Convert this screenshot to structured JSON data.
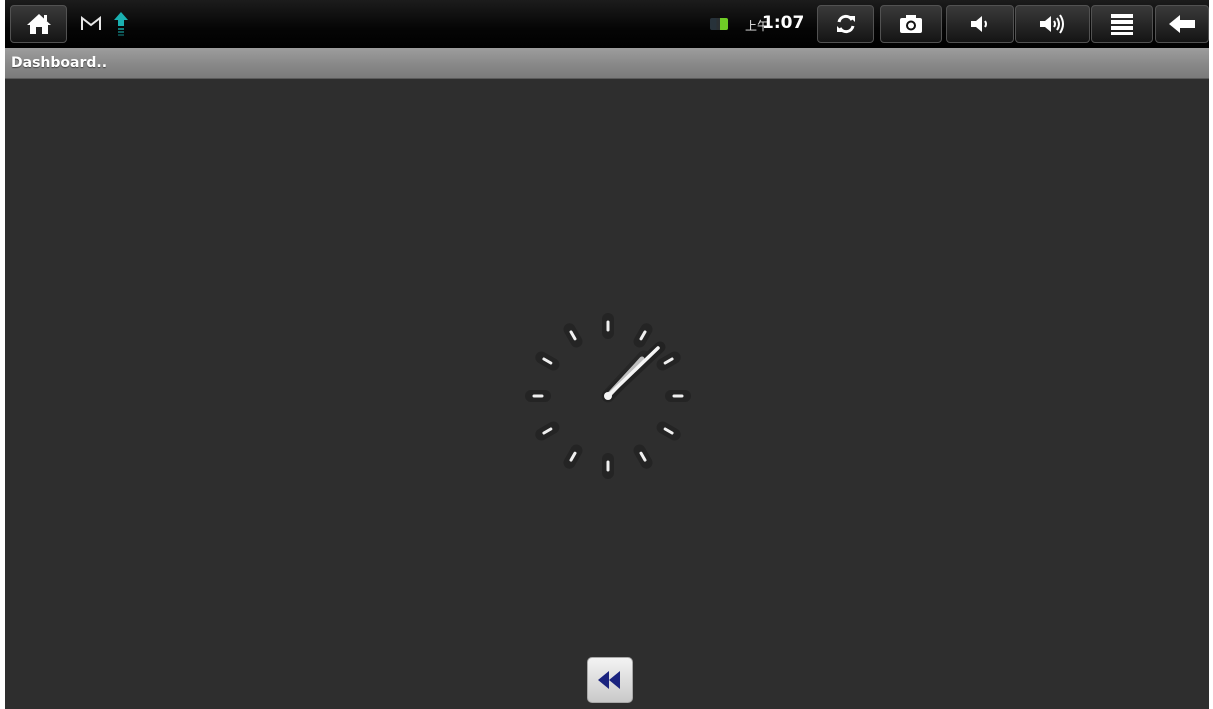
{
  "status_bar": {
    "notifications": [
      "home-icon",
      "gmail-icon",
      "upload-icon"
    ],
    "battery": {
      "level": 0.4,
      "color": "#6fcc26"
    },
    "time_prefix": "上午",
    "time": "1:07",
    "buttons": [
      "refresh-icon",
      "camera-icon",
      "volume-down-icon",
      "volume-up-icon",
      "menu-icon",
      "back-icon"
    ]
  },
  "title_bar": {
    "title": "Dashboard.."
  },
  "colors": {
    "background": "#2e2e2e",
    "status_bar": "#0a0a0a",
    "title_bar": "#8c8c8c",
    "rewind_arrow": "#1a237e",
    "upload_icon": "#1ab0b0"
  },
  "loading_indicator": {
    "icon": "clock-icon"
  },
  "footer": {
    "rewind_icon": "rewind-icon"
  }
}
